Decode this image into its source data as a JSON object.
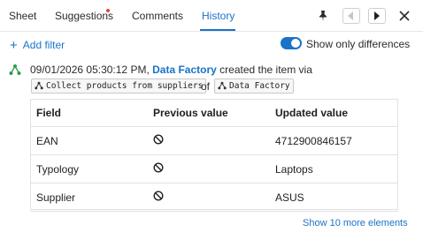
{
  "tabs": [
    {
      "label": "Sheet",
      "active": false
    },
    {
      "label": "Suggestions",
      "active": false,
      "has_notification": true
    },
    {
      "label": "Comments",
      "active": false
    },
    {
      "label": "History",
      "active": true
    }
  ],
  "toolbar_icons": [
    "pin-icon",
    "chevron-left-icon",
    "chevron-right-icon",
    "close-icon"
  ],
  "filters": {
    "add_label": "Add filter"
  },
  "toggle": {
    "label": "Show only differences",
    "on": true
  },
  "event": {
    "timestamp": "09/01/2026 05:30:12 PM,",
    "actor": "Data Factory",
    "action": "created the item via",
    "process_chip": "Collect products from suppliers",
    "of_text": "of",
    "source_chip": "Data Factory"
  },
  "table": {
    "headers": [
      "Field",
      "Previous value",
      "Updated value"
    ],
    "rows": [
      {
        "field": "EAN",
        "previous": "empty-icon",
        "updated": "4712900846157"
      },
      {
        "field": "Typology",
        "previous": "empty-icon",
        "updated": "Laptops"
      },
      {
        "field": "Supplier",
        "previous": "empty-icon",
        "updated": "ASUS"
      }
    ]
  },
  "more_link": "Show 10 more elements",
  "colors": {
    "accent": "#1a73c8",
    "notification": "#e0473f",
    "event_icon": "#2e9c4a"
  }
}
